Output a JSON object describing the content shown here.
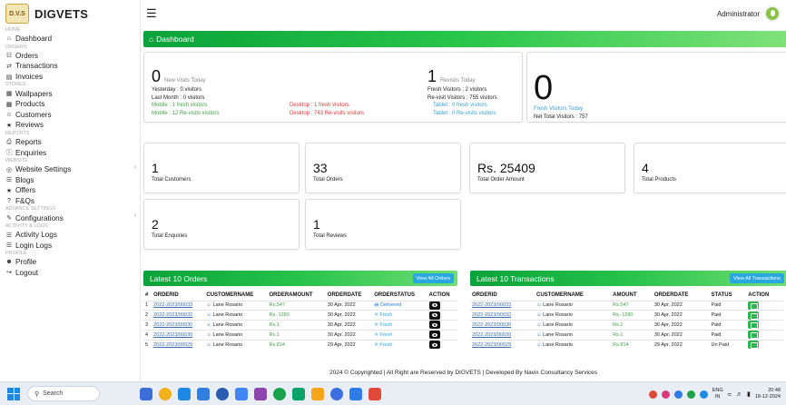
{
  "brand": {
    "name": "DIGVETS",
    "logo_text": "D.V.S"
  },
  "topbar": {
    "user": "Administrator"
  },
  "sidebar": {
    "groups": [
      {
        "title": "HOME",
        "items": [
          {
            "label": "Dashboard",
            "icon": "home-icon",
            "glyph": "⌂"
          }
        ]
      },
      {
        "title": "ORDERS",
        "items": [
          {
            "label": "Orders",
            "icon": "cart-icon",
            "glyph": "☷"
          },
          {
            "label": "Transactions",
            "icon": "exchange-icon",
            "glyph": "⇄"
          },
          {
            "label": "Invoices",
            "icon": "invoice-icon",
            "glyph": "▤"
          }
        ]
      },
      {
        "title": "STORES",
        "items": [
          {
            "label": "Wallpapers",
            "icon": "grid-icon",
            "glyph": "▦"
          },
          {
            "label": "Products",
            "icon": "grid-icon",
            "glyph": "▦"
          },
          {
            "label": "Customers",
            "icon": "users-icon",
            "glyph": "☺"
          },
          {
            "label": "Reviews",
            "icon": "star-icon",
            "glyph": "★"
          }
        ]
      },
      {
        "title": "REPORTS",
        "items": [
          {
            "label": "Reports",
            "icon": "print-icon",
            "glyph": "⎙"
          },
          {
            "label": "Enquiries",
            "icon": "info-icon",
            "glyph": "ⓘ"
          }
        ]
      },
      {
        "title": "WEBSITE",
        "items": [
          {
            "label": "Website Settings",
            "icon": "globe-icon",
            "glyph": "◎",
            "chevron": true
          },
          {
            "label": "Blogs",
            "icon": "list-icon",
            "glyph": "☰"
          },
          {
            "label": "Offers",
            "icon": "star-icon",
            "glyph": "★"
          },
          {
            "label": "F&Qs",
            "icon": "question-icon",
            "glyph": "?"
          }
        ]
      },
      {
        "title": "ADVANCE SETTINGS",
        "items": [
          {
            "label": "Configurations",
            "icon": "edit-icon",
            "glyph": "✎",
            "chevron": true
          }
        ]
      },
      {
        "title": "ACTIVITY & LOGS",
        "items": [
          {
            "label": "Activity Logs",
            "icon": "list-icon",
            "glyph": "☰"
          },
          {
            "label": "Login Logs",
            "icon": "list-icon",
            "glyph": "☰"
          }
        ]
      },
      {
        "title": "PROFILE",
        "items": [
          {
            "label": "Profile",
            "icon": "user-icon",
            "glyph": "☻"
          },
          {
            "label": "Logout",
            "icon": "logout-icon",
            "glyph": "↪"
          }
        ]
      }
    ]
  },
  "dashboard": {
    "title": "Dashboard",
    "new_visits": {
      "count": "0",
      "label": "New Visits Today",
      "yesterday": "Yesterday : 0 visitors",
      "last_month": "Last Month : 0 visitors",
      "mobile_fresh": "Mobile : 1 fresh visitors",
      "mobile_revisit": "Mobile : 12 Re-visits visitors",
      "desktop_fresh": "Desktop : 1 fresh visitors",
      "desktop_revisit": "Desktop : 743 Re-visits visitors"
    },
    "revisits": {
      "count": "1",
      "label": "Revisits Today",
      "fresh": "Fresh Visitors : 2 visitors",
      "revisit": "Re-visit Visitors : 755 visitors",
      "tablet_fresh": "Tablet : 0 fresh visitors",
      "tablet_revisit": "Tablet : 0 Re-visits visitors"
    },
    "fresh_today": {
      "count": "0",
      "label": "Fresh Visitors Today",
      "net": "Net Total Visitors : 757"
    },
    "stats": [
      {
        "value": "1",
        "label": "Total Customers"
      },
      {
        "value": "33",
        "label": "Total Orders"
      },
      {
        "value": "Rs. 25409",
        "label": "Total Order Amount"
      },
      {
        "value": "4",
        "label": "Total Products"
      },
      {
        "value": "2",
        "label": "Total Enquiries"
      },
      {
        "value": "1",
        "label": "Total Reviews"
      }
    ]
  },
  "orders": {
    "title": "Latest 10 Orders",
    "view_all": "View All Orders",
    "columns": [
      "#",
      "ORDERID",
      "CUSTOMERNAME",
      "ORDERAMOUNT",
      "ORDERDATE",
      "ORDERSTATUS",
      "ACTION"
    ],
    "rows": [
      {
        "n": "1",
        "id": "2022-2023/00033",
        "customer": "Lane Rosario",
        "amount": "Rs.547",
        "date": "30 Apr, 2022",
        "status": "Delivered"
      },
      {
        "n": "2",
        "id": "2022-2023/00032",
        "customer": "Lane Rosario",
        "amount": "Rs.-1280",
        "date": "30 Apr, 2022",
        "status": "Fresh"
      },
      {
        "n": "3",
        "id": "2022-2023/00030",
        "customer": "Lane Rosario",
        "amount": "Rs.1",
        "date": "30 Apr, 2022",
        "status": "Fresh"
      },
      {
        "n": "4",
        "id": "2022-2023/00030",
        "customer": "Lane Rosario",
        "amount": "Rs.1",
        "date": "30 Apr, 2022",
        "status": "Fresh"
      },
      {
        "n": "5",
        "id": "2022-2023/00029",
        "customer": "Lane Rosario",
        "amount": "Rs.814",
        "date": "29 Apr, 2022",
        "status": "Fresh"
      }
    ]
  },
  "transactions": {
    "title": "Latest 10 Transactions",
    "view_all": "View All Transactions",
    "columns": [
      "ORDERID",
      "CUSTOMERNAME",
      "AMOUNT",
      "ORDERDATE",
      "STATUS",
      "ACTION"
    ],
    "rows": [
      {
        "id": "2022-2023/00033",
        "customer": "Lane Rosario",
        "amount": "Rs.547",
        "date": "30 Apr, 2022",
        "status": "Paid"
      },
      {
        "id": "2022-2023/00032",
        "customer": "Lane Rosario",
        "amount": "Rs.-1280",
        "date": "30 Apr, 2022",
        "status": "Paid"
      },
      {
        "id": "2022-2023/00030",
        "customer": "Lane Rosario",
        "amount": "Rs.1",
        "date": "30 Apr, 2022",
        "status": "Paid"
      },
      {
        "id": "2022-2023/00030",
        "customer": "Lane Rosario",
        "amount": "Rs.1",
        "date": "30 Apr, 2022",
        "status": "Paid"
      },
      {
        "id": "2022-2023/00029",
        "customer": "Lane Rosario",
        "amount": "Rs.814",
        "date": "29 Apr, 2022",
        "status": "Un Paid"
      }
    ]
  },
  "footer": {
    "text": "2024 © Copyrighted | All Right are Reserved by DIGVETS | Developed By Navix Consultancy Services"
  },
  "taskbar": {
    "search_placeholder": "Search",
    "lang_top": "ENG",
    "lang_bottom": "IN",
    "time": "20:48",
    "date": "18-12-2024",
    "app_colors": [
      "#3b6fd8",
      "#f2b21b",
      "#1e88e5",
      "#2f7ee0",
      "#2a5db0",
      "#3e86f5",
      "#8e44ad",
      "#18a34a",
      "#0aa36a",
      "#f6a41b",
      "#3c6ee0",
      "#2f7be8",
      "#e0483a"
    ],
    "tray_colors": [
      "#e0483a",
      "#d93a7a",
      "#2f7be8",
      "#1fa14a",
      "#1e88e5"
    ]
  }
}
